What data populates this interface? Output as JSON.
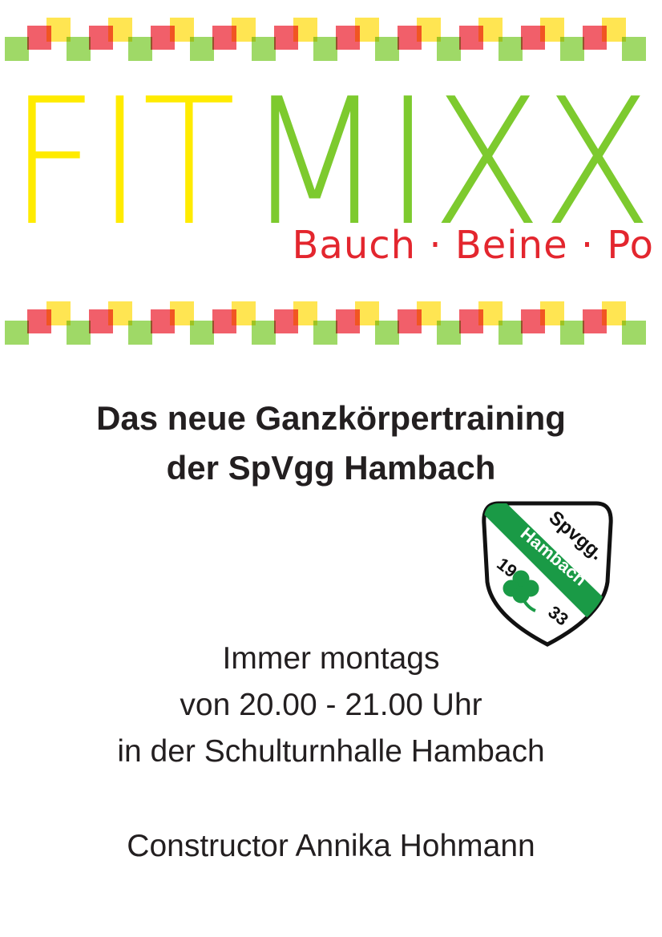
{
  "logo": {
    "word_left": "FIT",
    "word_right": "MIXX",
    "colors": {
      "fit": "#ffeb00",
      "mixx": "#7dca2e",
      "tagline": "#e3262e"
    },
    "tagline_parts": [
      "Bauch",
      "·",
      "Beine",
      "·",
      "Po"
    ]
  },
  "decor": {
    "colors": {
      "red": "#ef4350",
      "yellow": "#ffe133",
      "green": "#8ed34c"
    }
  },
  "headline": {
    "line1": "Das neue Ganzkörpertraining",
    "line2": "der SpVgg Hambach"
  },
  "crest": {
    "top_text": "Spvgg.",
    "band_text": "Hambach",
    "year_left": "19",
    "year_right": "33",
    "icon": "cloverleaf-icon",
    "colors": {
      "band": "#1a9a46",
      "outline": "#111111",
      "clover": "#1a9a46"
    }
  },
  "info": {
    "line1": "Immer montags",
    "line2": "von 20.00 - 21.00 Uhr",
    "line3": "in der Schulturnhalle Hambach",
    "line4": "Constructor Annika Hohmann"
  }
}
